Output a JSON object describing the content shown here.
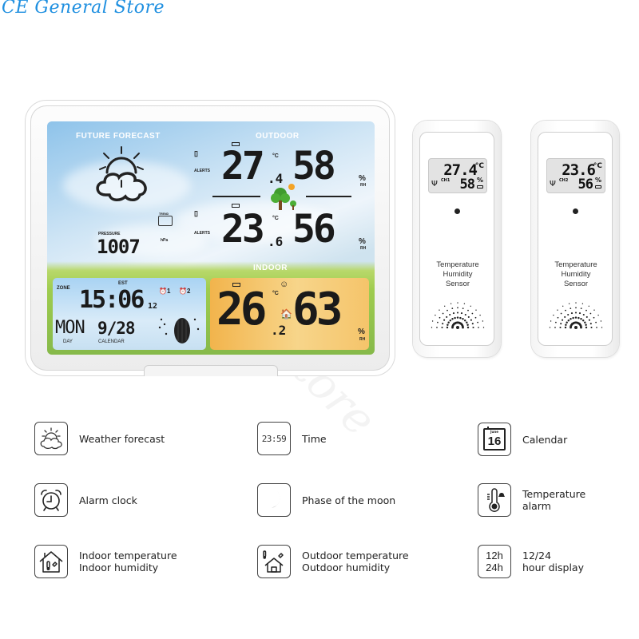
{
  "store": {
    "title": "CE General Store",
    "watermark": "CE General Store"
  },
  "station": {
    "forecast_label": "FUTURE FORECAST",
    "forecast_icon": "partly-cloudy-icon",
    "outdoor_label": "OUTDOOR",
    "ch1": {
      "temp_int": "27",
      "temp_dec": ".4",
      "temp_unit": "°C",
      "humidity": "58",
      "hum_unit": "%",
      "rh": "RH",
      "alerts": "ALERTS"
    },
    "ch2": {
      "temp_int": "23",
      "temp_dec": ".6",
      "temp_unit": "°C",
      "humidity": "56",
      "hum_unit": "%",
      "rh": "RH",
      "alerts": "ALERTS"
    },
    "pressure_label": "PRESSURE",
    "pressure_value": "1007",
    "pressure_unit": "hPa",
    "trend_label": "TREND",
    "zone_label": "ZONE",
    "est_label": "EST",
    "time": "15:06",
    "seconds": "12",
    "day": "MON",
    "day_label": "DAY",
    "date": "9/28",
    "calendar_label": "CALENDAR",
    "alarm1": "1",
    "alarm2": "2",
    "indoor_label": "INDOOR",
    "indoor": {
      "temp_int": "26",
      "temp_dec": ".2",
      "temp_unit": "°C",
      "humidity": "63",
      "hum_unit": "%",
      "rh": "RH"
    }
  },
  "sensors": [
    {
      "temp": "27.4",
      "temp_unit": "°C",
      "humidity": "58",
      "hum_unit": "%",
      "channel": "CH1",
      "caption_lines": [
        "Temperature",
        "Humidity",
        "Sensor"
      ]
    },
    {
      "temp": "23.6",
      "temp_unit": "°C",
      "humidity": "56",
      "hum_unit": "%",
      "channel": "CH2",
      "caption_lines": [
        "Temperature",
        "Humidity",
        "Sensor"
      ]
    }
  ],
  "features": [
    {
      "icon": "weather-forecast-icon",
      "lines": [
        "Weather forecast"
      ]
    },
    {
      "icon": "time-icon",
      "icon_text": "23:59",
      "lines": [
        "Time"
      ]
    },
    {
      "icon": "calendar-icon",
      "icon_text": "16",
      "icon_month": "June",
      "lines": [
        "Calendar"
      ]
    },
    {
      "icon": "alarm-clock-icon",
      "lines": [
        "Alarm clock"
      ]
    },
    {
      "icon": "moon-phase-icon",
      "lines": [
        "Phase of the moon"
      ]
    },
    {
      "icon": "temperature-alarm-icon",
      "lines": [
        "Temperature",
        "alarm"
      ]
    },
    {
      "icon": "indoor-house-icon",
      "lines": [
        "Indoor temperature",
        "Indoor humidity"
      ]
    },
    {
      "icon": "outdoor-house-icon",
      "lines": [
        "Outdoor temperature",
        "Outdoor humidity"
      ]
    },
    {
      "icon": "hour-format-icon",
      "icon_text_1": "12h",
      "icon_text_2": "24h",
      "lines": [
        "12/24",
        "hour display"
      ]
    }
  ]
}
